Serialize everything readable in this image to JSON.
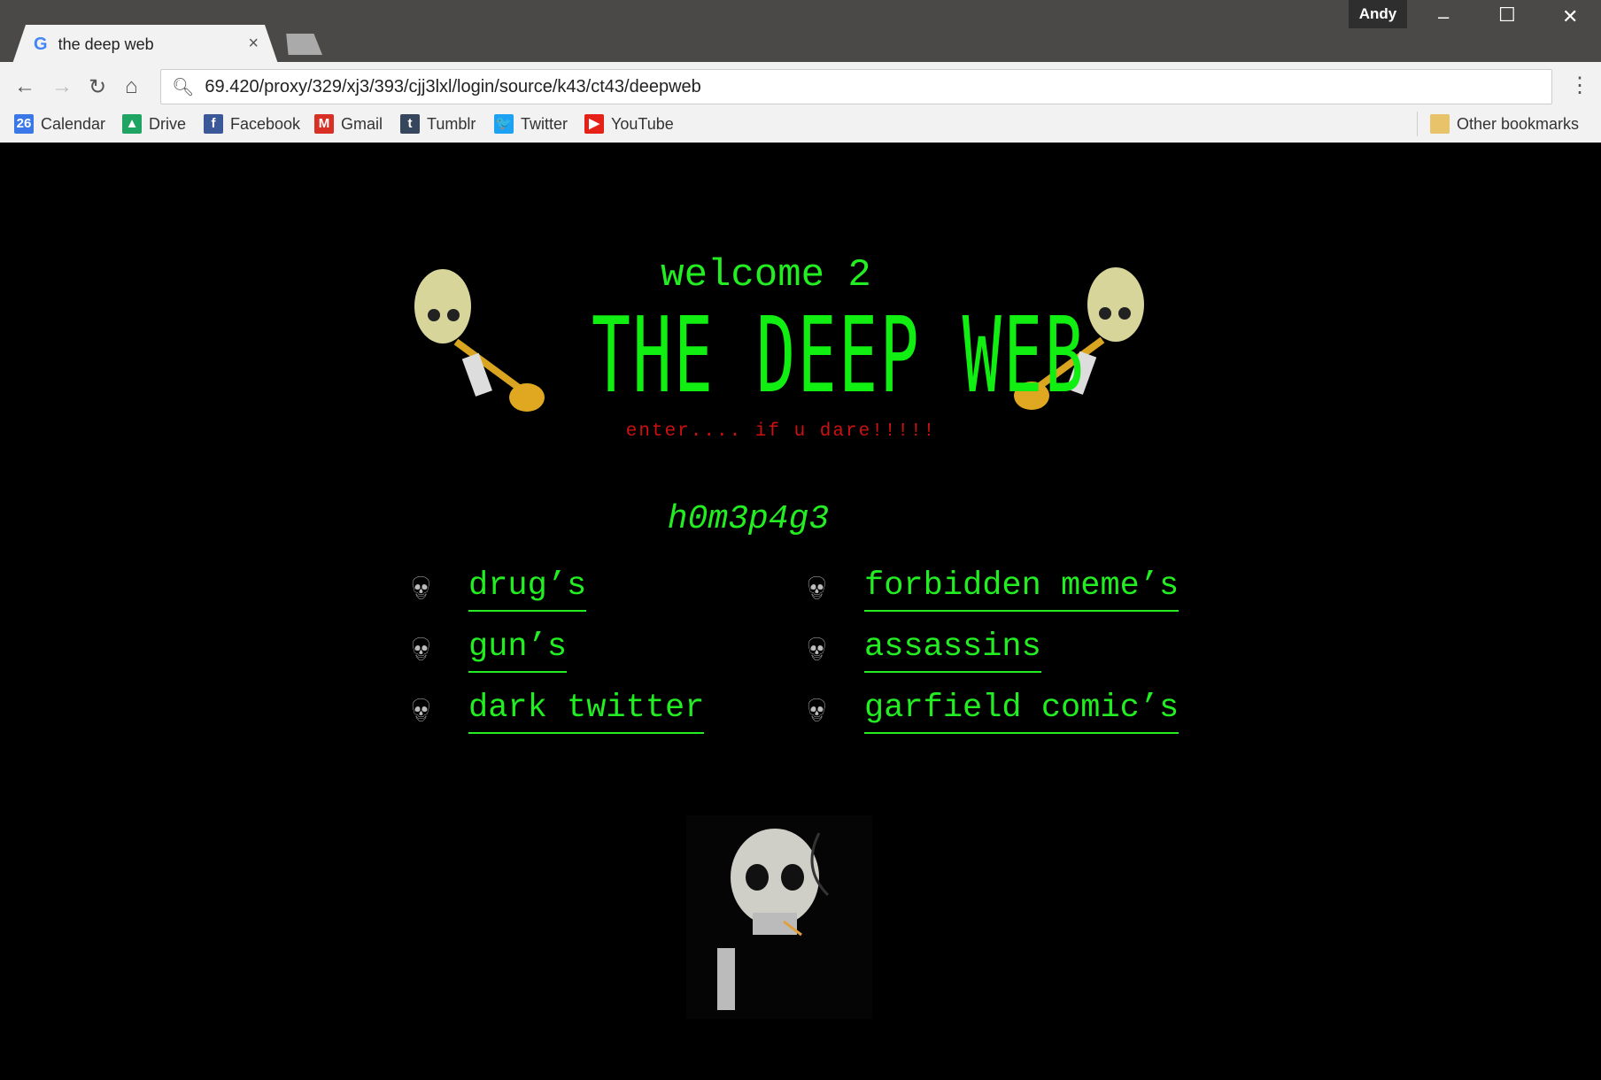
{
  "browser": {
    "tab_title": "the deep web",
    "tab_close": "×",
    "user": "Andy",
    "url": "69.420/proxy/329/xj3/393/cjj3lxl/login/source/k43/ct43/deepweb",
    "bookmarks": [
      {
        "label": "Calendar",
        "icon": "calendar-icon",
        "glyph": "26",
        "color": "#3b78e7"
      },
      {
        "label": "Drive",
        "icon": "drive-icon",
        "glyph": "▲",
        "color": "#1fa463"
      },
      {
        "label": "Facebook",
        "icon": "facebook-icon",
        "glyph": "f",
        "color": "#3b5998"
      },
      {
        "label": "Gmail",
        "icon": "gmail-icon",
        "glyph": "M",
        "color": "#d93025"
      },
      {
        "label": "Tumblr",
        "icon": "tumblr-icon",
        "glyph": "t",
        "color": "#36465d"
      },
      {
        "label": "Twitter",
        "icon": "twitter-icon",
        "glyph": "🐦",
        "color": "#1da1f2"
      },
      {
        "label": "YouTube",
        "icon": "youtube-icon",
        "glyph": "▶",
        "color": "#e62117"
      }
    ],
    "other_bookmarks": "Other bookmarks"
  },
  "page": {
    "welcome": "welcome 2",
    "title": "THE DEEP WEB",
    "tagline": "enter.... if u dare!!!!!",
    "homepage": "h0m3p4g3",
    "links_left": [
      "drug’s",
      "gun’s",
      "dark twitter"
    ],
    "links_right": [
      "forbidden meme’s",
      "assassins",
      "garfield comic’s"
    ],
    "colors": {
      "green": "#22ee22",
      "red": "#cc1111",
      "background": "#000000"
    }
  }
}
